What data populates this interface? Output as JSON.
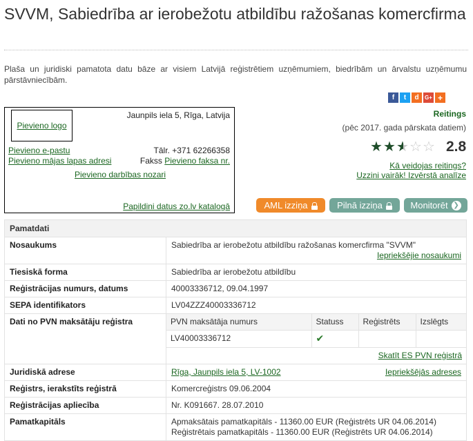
{
  "page": {
    "title": "SVVM, Sabiedrība ar ierobežotu atbildību ražošanas komercfirma",
    "intro": "Plaša un juridiski pamatota datu bāze ar visiem Latvijā reģistrētiem uzņēmumiem, biedrībām un ārvalstu uzņēmumu pārstāvniecībām."
  },
  "share": {
    "icons": [
      "facebook-icon",
      "twitter-icon",
      "draugiem-icon",
      "google-plus-icon",
      "add-share-icon"
    ],
    "facebook": "f",
    "twitter": "t",
    "draugiem": "d",
    "google": "G+",
    "add": "+",
    "colors": {
      "facebook": "#3b5998",
      "twitter": "#1da1f2",
      "draugiem": "#f36f21",
      "google": "#dd4b39",
      "add": "#f36f21"
    }
  },
  "card": {
    "add_logo": "Pievieno logo",
    "address": "Jaunpils iela 5, Rīga, Latvija",
    "add_email": "Pievieno e-pastu",
    "add_web": "Pievieno mājas lapas adresi",
    "phone_label": "Tālr.",
    "phone": "+371 62266358",
    "fax_label": "Fakss",
    "add_fax": "Pievieno faksa nr.",
    "add_industry": "Pievieno darbības nozari",
    "catalog_link": "Papildini datus zo.lv katalogā"
  },
  "rating": {
    "title": "Reitings",
    "subtitle": "(pēc 2017. gada pārskata datiem)",
    "stars_value": 2.5,
    "stars_max": 5,
    "score": "2.8",
    "how_link": "Kā veidojas reitings?",
    "more_link": "Uzzini vairāk! Izvērstā analīze"
  },
  "buttons": {
    "aml": "AML izziņa",
    "full": "Pilnā izziņa",
    "monitor": "Monitorēt",
    "colors": {
      "aml": "#f08a2a",
      "full": "#73a699",
      "monitor": "#73a699"
    }
  },
  "table": {
    "section": "Pamatdati",
    "name_label": "Nosaukums",
    "name_value": "Sabiedrība ar ierobežotu atbildību ražošanas komercfirma \"SVVM\"",
    "name_prev": "Iepriekšējie nosaukumi",
    "legal_form_label": "Tiesiskā forma",
    "legal_form_value": "Sabiedrība ar ierobežotu atbildību",
    "reg_label": "Reģistrācijas numurs, datums",
    "reg_value": "40003336712, 09.04.1997",
    "sepa_label": "SEPA identifikators",
    "sepa_value": "LV04ZZZ40003336712",
    "pvn_label": "Dati no PVN maksātāju reģistra",
    "pvn_headers": [
      "PVN maksātāja numurs",
      "Statuss",
      "Reģistrēts",
      "Izslēgts"
    ],
    "pvn_number": "LV40003336712",
    "pvn_status": "✔",
    "pvn_link": "Skatīt ES PVN reģistrā",
    "address_label": "Juridiskā adrese",
    "address_value": "Rīga, Jaunpils iela 5, LV-1002",
    "address_prev": "Iepriekšējās adreses",
    "registry_label": "Reģistrs, ierakstīts reģistrā",
    "registry_value": "Komercreģistrs 09.06.2004",
    "cert_label": "Reģistrācijas apliecība",
    "cert_value": "Nr. K091667. 28.07.2010",
    "capital_label": "Pamatkapitāls",
    "capital_paid": "Apmaksātais pamatkapitāls - 11360.00 EUR (Reģistrēts UR 04.06.2014)",
    "capital_registered": "Reģistrētais pamatkapitāls - 11360.00 EUR (Reģistrēts UR 04.06.2014)"
  }
}
